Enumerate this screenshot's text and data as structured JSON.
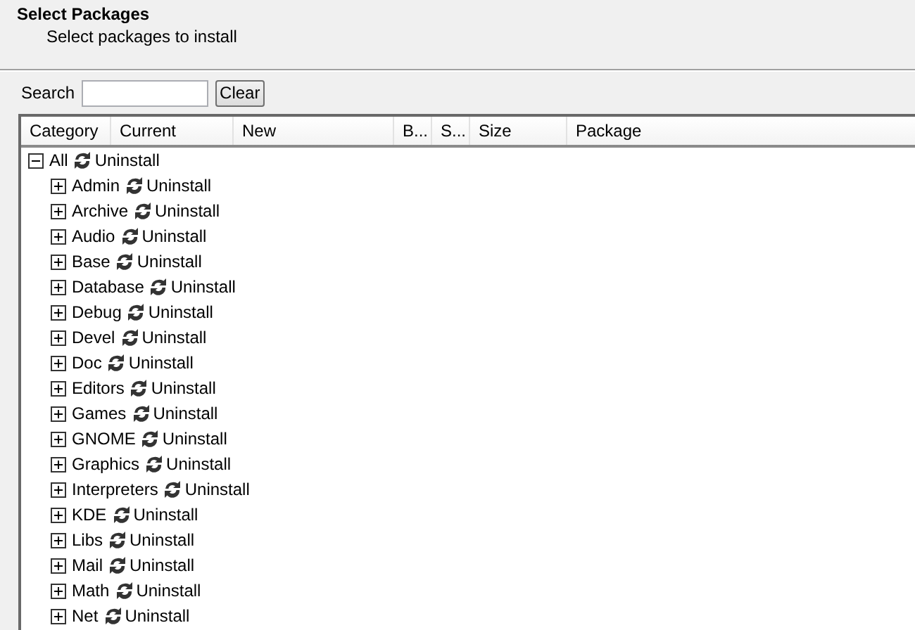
{
  "header": {
    "title": "Select Packages",
    "subtitle": "Select packages to install"
  },
  "search": {
    "label": "Search",
    "clear_button": "Clear"
  },
  "table": {
    "columns": [
      "Category",
      "Current",
      "New",
      "B...",
      "S...",
      "Size",
      "Package"
    ],
    "tree": [
      {
        "label": "All",
        "action": "Uninstall",
        "expanded": true,
        "children": [
          {
            "label": "Admin",
            "action": "Uninstall",
            "expanded": false
          },
          {
            "label": "Archive",
            "action": "Uninstall",
            "expanded": false
          },
          {
            "label": "Audio",
            "action": "Uninstall",
            "expanded": false
          },
          {
            "label": "Base",
            "action": "Uninstall",
            "expanded": false
          },
          {
            "label": "Database",
            "action": "Uninstall",
            "expanded": false
          },
          {
            "label": "Debug",
            "action": "Uninstall",
            "expanded": false
          },
          {
            "label": "Devel",
            "action": "Uninstall",
            "expanded": false
          },
          {
            "label": "Doc",
            "action": "Uninstall",
            "expanded": false
          },
          {
            "label": "Editors",
            "action": "Uninstall",
            "expanded": false
          },
          {
            "label": "Games",
            "action": "Uninstall",
            "expanded": false
          },
          {
            "label": "GNOME",
            "action": "Uninstall",
            "expanded": false
          },
          {
            "label": "Graphics",
            "action": "Uninstall",
            "expanded": false
          },
          {
            "label": "Interpreters",
            "action": "Uninstall",
            "expanded": false
          },
          {
            "label": "KDE",
            "action": "Uninstall",
            "expanded": false
          },
          {
            "label": "Libs",
            "action": "Uninstall",
            "expanded": false
          },
          {
            "label": "Mail",
            "action": "Uninstall",
            "expanded": false
          },
          {
            "label": "Math",
            "action": "Uninstall",
            "expanded": false
          },
          {
            "label": "Net",
            "action": "Uninstall",
            "expanded": false
          }
        ]
      }
    ]
  }
}
